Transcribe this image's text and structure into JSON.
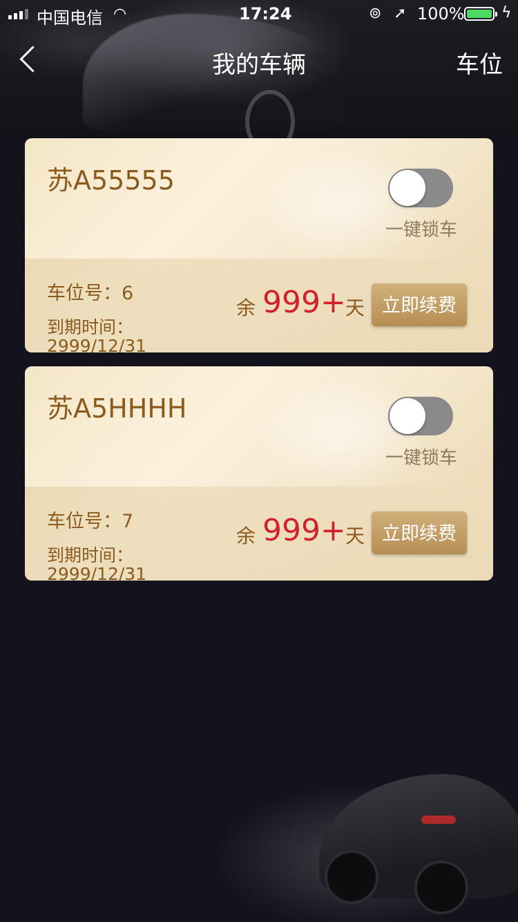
{
  "status_bar": {
    "carrier": "中国电信",
    "time": "17:24",
    "battery_percent": "100%",
    "wifi_icon": "wifi-icon",
    "lock_icon": "orientation-lock-icon",
    "location_icon": "location-arrow-icon",
    "charging_icon": "bolt-icon"
  },
  "nav": {
    "title": "我的车辆",
    "right_label": "车位",
    "back_icon": "chevron-left-icon"
  },
  "vehicles": [
    {
      "plate": "苏A55555",
      "lock_toggle_on": false,
      "lock_label": "一键锁车",
      "space": "车位号：6",
      "expire_label": "到期时间：",
      "expire_date": "2999/12/31",
      "remain_prefix": "余",
      "remain_days": "999+",
      "remain_suffix": "天",
      "renew_label": "立即续费"
    },
    {
      "plate": "苏A5HHHH",
      "lock_toggle_on": false,
      "lock_label": "一键锁车",
      "space": "车位号：7",
      "expire_label": "到期时间：",
      "expire_date": "2999/12/31",
      "remain_prefix": "余",
      "remain_days": "999+",
      "remain_suffix": "天",
      "renew_label": "立即续费"
    }
  ],
  "colors": {
    "gold_text": "#8b5a1e",
    "days_red": "#d0202a",
    "button_gold": "#b58e54",
    "battery_green": "#4cd964"
  }
}
